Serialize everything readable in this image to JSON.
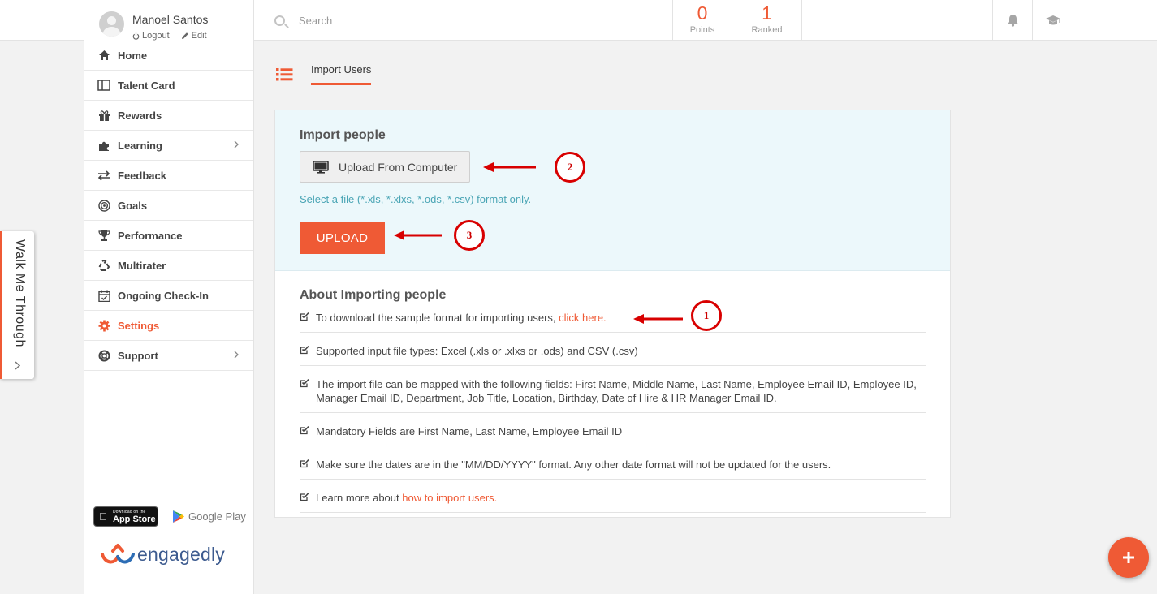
{
  "user": {
    "name": "Manoel Santos",
    "logout_label": "Logout",
    "edit_label": "Edit"
  },
  "search": {
    "placeholder": "Search"
  },
  "stats": [
    {
      "value": "0",
      "label": "Points"
    },
    {
      "value": "1",
      "label": "Ranked"
    }
  ],
  "top_icons": [
    "bell-icon",
    "graduation-cap-icon"
  ],
  "sidebar": {
    "items": [
      {
        "label": "Home",
        "icon": "home-icon",
        "has_submenu": false,
        "active": false
      },
      {
        "label": "Talent Card",
        "icon": "talent-card-icon",
        "has_submenu": false,
        "active": false
      },
      {
        "label": "Rewards",
        "icon": "gift-icon",
        "has_submenu": false,
        "active": false
      },
      {
        "label": "Learning",
        "icon": "puzzle-icon",
        "has_submenu": true,
        "active": false
      },
      {
        "label": "Feedback",
        "icon": "exchange-icon",
        "has_submenu": false,
        "active": false
      },
      {
        "label": "Goals",
        "icon": "target-icon",
        "has_submenu": false,
        "active": false
      },
      {
        "label": "Performance",
        "icon": "trophy-icon",
        "has_submenu": false,
        "active": false
      },
      {
        "label": "Multirater",
        "icon": "recycle-icon",
        "has_submenu": false,
        "active": false
      },
      {
        "label": "Ongoing Check-In",
        "icon": "calendar-check-icon",
        "has_submenu": false,
        "active": false
      },
      {
        "label": "Settings",
        "icon": "gear-icon",
        "has_submenu": false,
        "active": true
      },
      {
        "label": "Support",
        "icon": "lifebuoy-icon",
        "has_submenu": true,
        "active": false
      }
    ],
    "app_store": {
      "small": "Download on the",
      "big": "App Store"
    },
    "google_play": "Google Play",
    "brand": "engagedly"
  },
  "walk_me_through": "Walk Me Through",
  "tab": {
    "label": "Import Users"
  },
  "import": {
    "title": "Import people",
    "upload_from_computer": "Upload From Computer",
    "hint": "Select a file (*.xls, *.xlxs, *.ods, *.csv) format only.",
    "upload_button": "UPLOAD"
  },
  "about": {
    "title": "About Importing people",
    "items": [
      {
        "text": "To download the sample format for importing users, ",
        "link": "click here."
      },
      {
        "text": "Supported input file types: Excel (.xls or .xlxs or .ods) and CSV (.csv)",
        "link": ""
      },
      {
        "text": "The import file can be mapped with the following fields: First Name, Middle Name, Last Name, Employee Email ID, Employee ID, Manager Email ID, Department, Job Title, Location, Birthday, Date of Hire & HR Manager Email ID.",
        "link": ""
      },
      {
        "text": "Mandatory Fields are First Name, Last Name, Employee Email ID",
        "link": ""
      },
      {
        "text": "Make sure the dates are in the \"MM/DD/YYYY\" format. Any other date format will not be updated for the users.",
        "link": ""
      },
      {
        "text": "Learn more about ",
        "link": "how to import users."
      }
    ]
  },
  "annotations": [
    "1",
    "2",
    "3"
  ],
  "colors": {
    "accent": "#ef5a35",
    "hint": "#4aa5b5",
    "annotation": "#d80000",
    "panel_bg": "#ecf8fb"
  }
}
